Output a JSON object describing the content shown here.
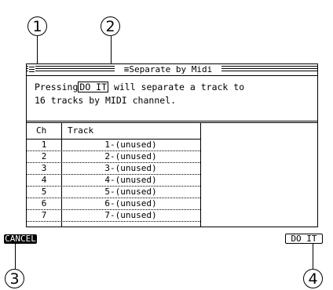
{
  "dialog": {
    "title": "Separate by Midi",
    "message_line1_before": "Pressing",
    "message_inline_button": "DO IT",
    "message_line1_after": "will separate a track to",
    "message_line2": "16 tracks by MIDI channel."
  },
  "table": {
    "headers": {
      "ch": "Ch",
      "track": "Track"
    },
    "rows": [
      {
        "ch": "1",
        "track": "1-(unused)"
      },
      {
        "ch": "2",
        "track": "2-(unused)"
      },
      {
        "ch": "3",
        "track": "3-(unused)"
      },
      {
        "ch": "4",
        "track": "4-(unused)"
      },
      {
        "ch": "5",
        "track": "5-(unused)"
      },
      {
        "ch": "6",
        "track": "6-(unused)"
      },
      {
        "ch": "7",
        "track": "7-(unused)"
      }
    ]
  },
  "buttons": {
    "cancel": "CANCEL",
    "do_it": "DO IT"
  },
  "callouts": [
    "1",
    "2",
    "3",
    "4"
  ]
}
